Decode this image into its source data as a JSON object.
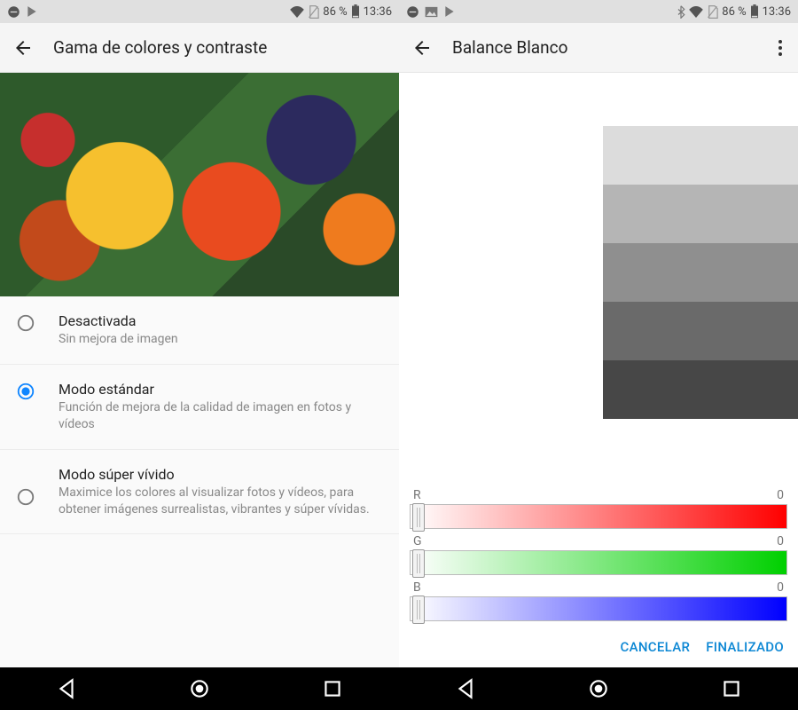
{
  "status": {
    "battery_pct": "86 %",
    "time": "13:36"
  },
  "left": {
    "title": "Gama de colores y contraste",
    "options": [
      {
        "title": "Desactivada",
        "sub": "Sin mejora de imagen",
        "selected": false
      },
      {
        "title": "Modo estándar",
        "sub": "Función de mejora de la calidad de imagen en fotos y vídeos",
        "selected": true
      },
      {
        "title": "Modo súper vívido",
        "sub": "Maximice los colores al visualizar fotos y vídeos, para obtener imágenes surrealistas, vibrantes y súper vívidas.",
        "selected": false
      }
    ]
  },
  "right": {
    "title": "Balance Blanco",
    "sliders": {
      "r": {
        "label": "R",
        "value": "0"
      },
      "g": {
        "label": "G",
        "value": "0"
      },
      "b": {
        "label": "B",
        "value": "0"
      }
    },
    "actions": {
      "cancel": "CANCELAR",
      "done": "FINALIZADO"
    }
  }
}
